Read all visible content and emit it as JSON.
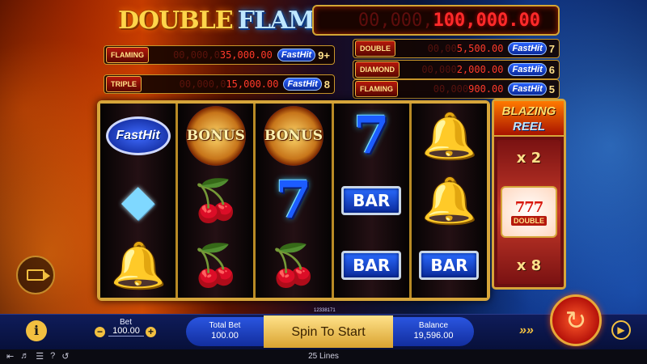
{
  "logo": {
    "word1": "DOUBLE",
    "word2": "FLAME"
  },
  "jackpots": {
    "main": {
      "ghost": "00,000,",
      "value": "100,000.00"
    },
    "left": [
      {
        "badge": "FLAMING",
        "ghost": "00,000,0",
        "value": "35,000.00",
        "fasthit": "FastHit",
        "count": "9+"
      },
      {
        "badge": "TRIPLE",
        "ghost": "00,000,0",
        "value": "15,000.00",
        "fasthit": "FastHit",
        "count": "8"
      }
    ],
    "right": [
      {
        "badge": "DOUBLE",
        "ghost": "00,00",
        "value": "5,500.00",
        "fasthit": "FastHit",
        "count": "7"
      },
      {
        "badge": "DIAMOND",
        "ghost": "00,000",
        "value": "2,000.00",
        "fasthit": "FastHit",
        "count": "6"
      },
      {
        "badge": "FLAMING",
        "ghost": "00,000",
        "value": "900.00",
        "fasthit": "FastHit",
        "count": "5"
      }
    ]
  },
  "reels": [
    [
      {
        "type": "fasthit",
        "label": "FastHit"
      },
      {
        "type": "diamond",
        "icon": "diamond-icon"
      },
      {
        "type": "bell",
        "icon": "bell-icon"
      }
    ],
    [
      {
        "type": "bonus",
        "label": "BONUS"
      },
      {
        "type": "cherry",
        "icon": "cherry-icon"
      },
      {
        "type": "cherry",
        "icon": "cherry-icon"
      }
    ],
    [
      {
        "type": "bonus",
        "label": "BONUS"
      },
      {
        "type": "seven",
        "label": "7"
      },
      {
        "type": "cherry",
        "icon": "cherry-icon"
      }
    ],
    [
      {
        "type": "seven",
        "label": "7"
      },
      {
        "type": "bar",
        "label": "BAR"
      },
      {
        "type": "bar",
        "label": "BAR"
      }
    ],
    [
      {
        "type": "bell",
        "icon": "bell-icon"
      },
      {
        "type": "bell",
        "icon": "bell-icon"
      },
      {
        "type": "bar",
        "label": "BAR"
      }
    ]
  ],
  "blazing_reel": {
    "title1": "BLAZING",
    "title2": "REEL",
    "mult_top": "x 2",
    "symbol_sevens": "777",
    "symbol_label": "DOUBLE",
    "mult_bottom": "x 8"
  },
  "controls": {
    "bet_label": "Bet",
    "bet_value": "100.00",
    "total_bet_label": "Total Bet",
    "total_bet_value": "100.00",
    "spin_label": "Spin To Start",
    "ticket_id": "12338171",
    "balance_label": "Balance",
    "balance_value": "19,596.00"
  },
  "footer": {
    "lines": "25 Lines"
  },
  "colors": {
    "gold": "#d6a53a",
    "jackpot_red": "#ff2a2a",
    "bar_blue": "#122e9e",
    "spin_gold": "#ffe28a"
  }
}
